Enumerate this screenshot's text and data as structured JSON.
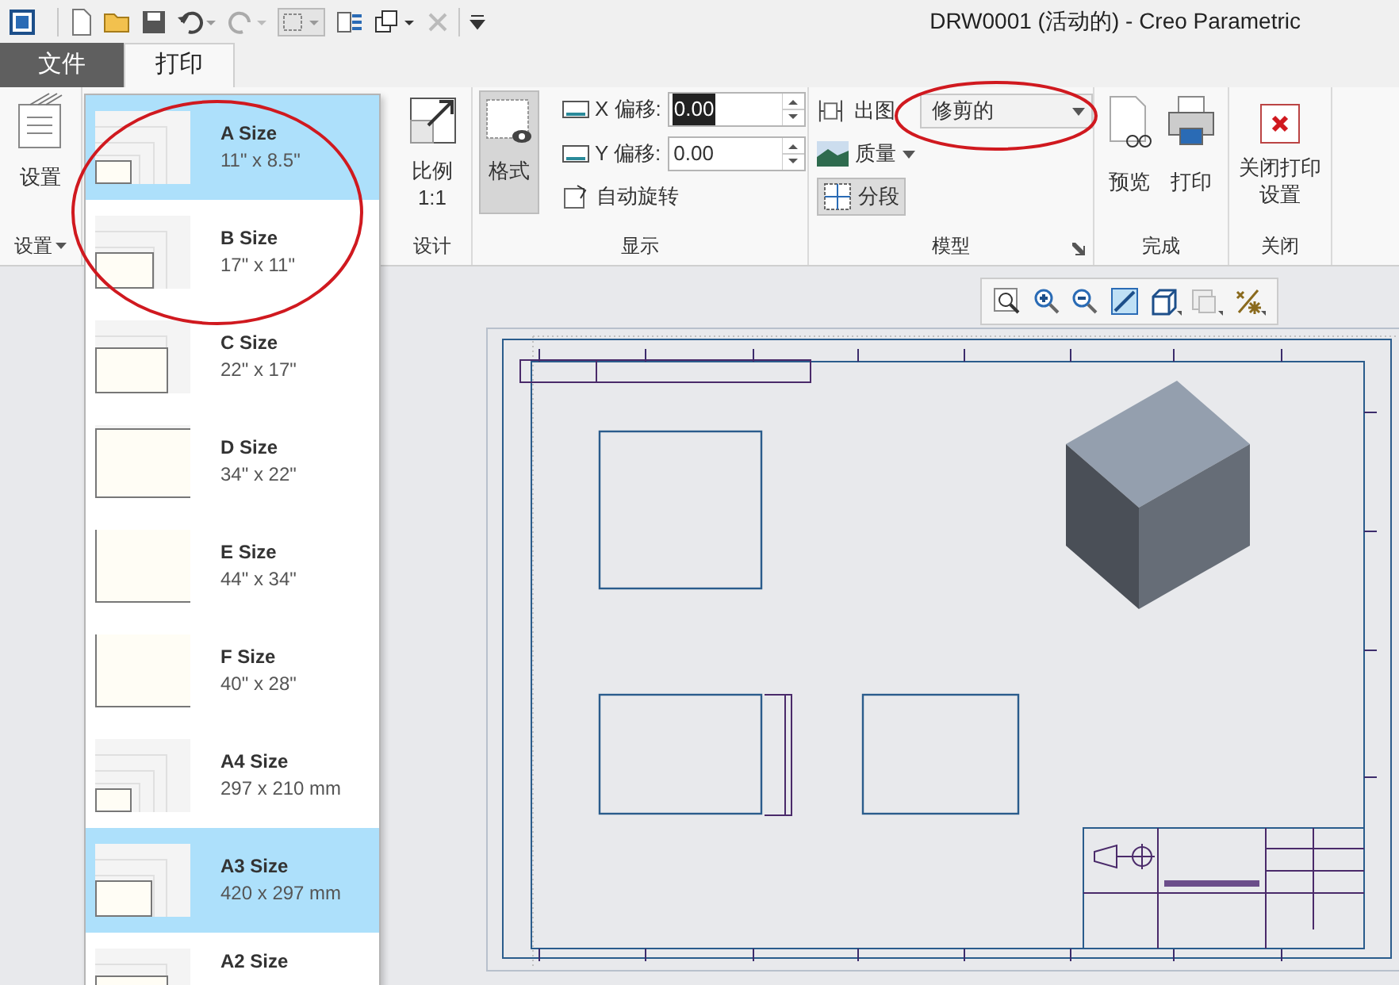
{
  "window": {
    "title": "DRW0001 (活动的) - Creo Parametric"
  },
  "tabs": [
    {
      "label": "文件",
      "kind": "file",
      "selected": false
    },
    {
      "label": "打印",
      "kind": "tab",
      "selected": true
    }
  ],
  "setup_group": {
    "button": "设置",
    "label": "设置"
  },
  "design_group": {
    "button": "比例\n1:1",
    "label": "设计"
  },
  "display_group": {
    "format_button": {
      "label": "格式",
      "selected": true
    },
    "x_offset": {
      "label": "X 偏移:",
      "value": "0.00",
      "highlighted": true
    },
    "y_offset": {
      "label": "Y 偏移:",
      "value": "0.00",
      "highlighted": false
    },
    "auto_rotate": "自动旋转",
    "label": "显示"
  },
  "model_group": {
    "output_label": "出图",
    "output_value": "修剪的",
    "quality": "质量",
    "segment": {
      "label": "分段",
      "selected": true
    },
    "label": "模型"
  },
  "finish_group": {
    "buttons": [
      "预览",
      "打印"
    ],
    "label": "完成"
  },
  "close_group": {
    "button": "关闭打印设置",
    "label": "关闭"
  },
  "paper_sizes": [
    {
      "name": "A Size",
      "dims": "11\" x 8.5\"",
      "selected": true
    },
    {
      "name": "B Size",
      "dims": "17\" x 11\"",
      "selected": false
    },
    {
      "name": "C Size",
      "dims": "22\" x 17\"",
      "selected": false
    },
    {
      "name": "D Size",
      "dims": "34\" x 22\"",
      "selected": false
    },
    {
      "name": "E Size",
      "dims": "44\" x 34\"",
      "selected": false
    },
    {
      "name": "F Size",
      "dims": "40\" x 28\"",
      "selected": false
    },
    {
      "name": "A4 Size",
      "dims": "297 x 210 mm",
      "selected": false
    },
    {
      "name": "A3 Size",
      "dims": "420 x 297 mm",
      "selected": true
    },
    {
      "name": "A2 Size",
      "selected": false
    }
  ]
}
